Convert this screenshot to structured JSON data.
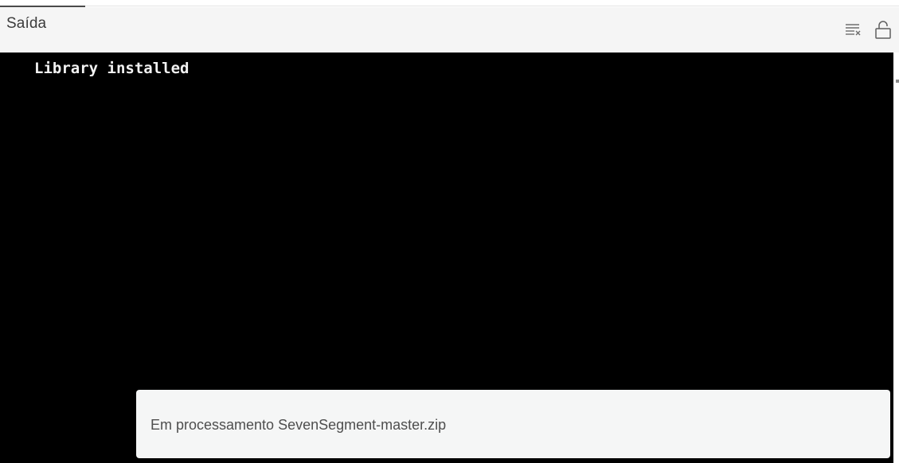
{
  "panel": {
    "title": "Saída",
    "clear_icon": "clear-output-icon",
    "lock_icon": "unlocked-padlock-icon"
  },
  "output": {
    "lines": [
      "Library installed"
    ]
  },
  "notification": {
    "message": "Em processamento SevenSegment-master.zip"
  }
}
